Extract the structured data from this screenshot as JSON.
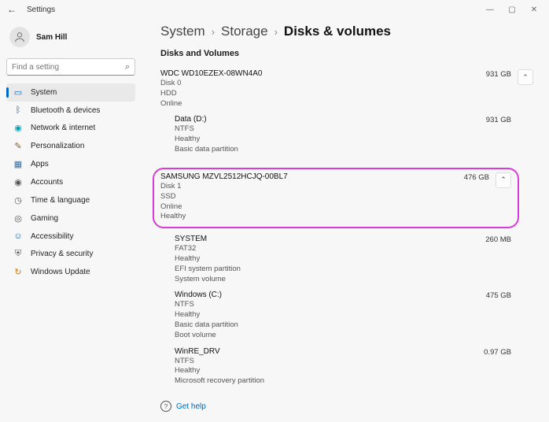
{
  "titlebar": {
    "title": "Settings"
  },
  "user": {
    "name": "Sam Hill"
  },
  "search": {
    "placeholder": "Find a setting"
  },
  "nav": {
    "items": [
      {
        "label": "System"
      },
      {
        "label": "Bluetooth & devices"
      },
      {
        "label": "Network & internet"
      },
      {
        "label": "Personalization"
      },
      {
        "label": "Apps"
      },
      {
        "label": "Accounts"
      },
      {
        "label": "Time & language"
      },
      {
        "label": "Gaming"
      },
      {
        "label": "Accessibility"
      },
      {
        "label": "Privacy & security"
      },
      {
        "label": "Windows Update"
      }
    ]
  },
  "breadcrumb": {
    "a": "System",
    "b": "Storage",
    "c": "Disks & volumes"
  },
  "section": {
    "title": "Disks and Volumes"
  },
  "disks": [
    {
      "name": "WDC WD10EZEX-08WN4A0",
      "size": "931 GB",
      "meta": [
        "Disk 0",
        "HDD",
        "Online"
      ],
      "volumes": [
        {
          "name": "Data (D:)",
          "size": "931 GB",
          "meta": [
            "NTFS",
            "Healthy",
            "Basic data partition"
          ]
        }
      ]
    },
    {
      "name": "SAMSUNG MZVL2512HCJQ-00BL7",
      "size": "476 GB",
      "meta": [
        "Disk 1",
        "SSD",
        "Online",
        "Healthy"
      ],
      "highlight": true,
      "volumes": [
        {
          "name": "SYSTEM",
          "size": "260 MB",
          "meta": [
            "FAT32",
            "Healthy",
            "EFI system partition",
            "System volume"
          ]
        },
        {
          "name": "Windows (C:)",
          "size": "475 GB",
          "meta": [
            "NTFS",
            "Healthy",
            "Basic data partition",
            "Boot volume"
          ]
        },
        {
          "name": "WinRE_DRV",
          "size": "0.97 GB",
          "meta": [
            "NTFS",
            "Healthy",
            "Microsoft recovery partition"
          ]
        }
      ]
    }
  ],
  "help": {
    "label": "Get help"
  }
}
